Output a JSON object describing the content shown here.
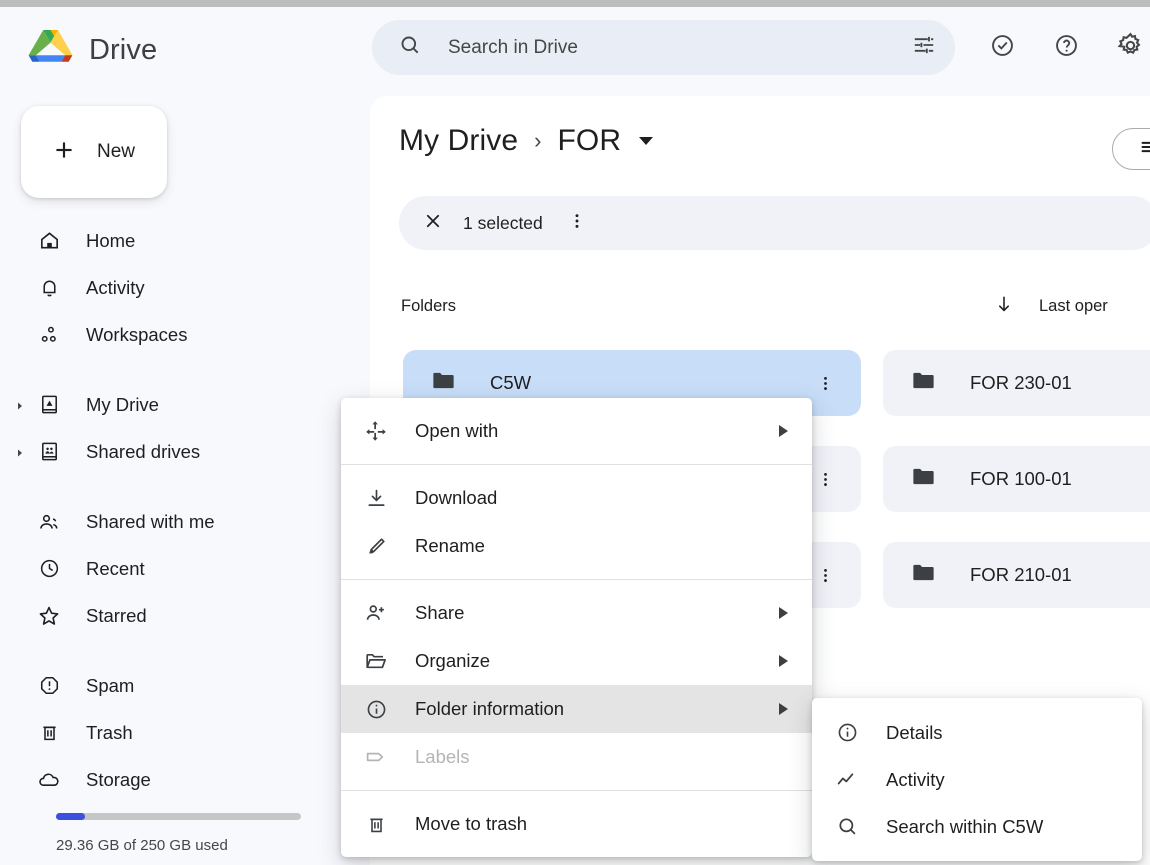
{
  "app": {
    "name": "Drive",
    "logo_icon": "google-drive-logo"
  },
  "sidebar": {
    "new_button": {
      "label": "New",
      "icon": "plus-icon"
    },
    "items": [
      {
        "label": "Home",
        "icon": "home-icon",
        "expandable": false
      },
      {
        "label": "Activity",
        "icon": "bell-icon",
        "expandable": false
      },
      {
        "label": "Workspaces",
        "icon": "workspaces-icon",
        "expandable": false
      },
      {
        "label": "My Drive",
        "icon": "my-drive-icon",
        "expandable": true
      },
      {
        "label": "Shared drives",
        "icon": "shared-drives-icon",
        "expandable": true
      },
      {
        "label": "Shared with me",
        "icon": "people-icon",
        "expandable": false
      },
      {
        "label": "Recent",
        "icon": "clock-icon",
        "expandable": false
      },
      {
        "label": "Starred",
        "icon": "star-icon",
        "expandable": false
      },
      {
        "label": "Spam",
        "icon": "spam-icon",
        "expandable": false
      },
      {
        "label": "Trash",
        "icon": "trash-icon",
        "expandable": false
      },
      {
        "label": "Storage",
        "icon": "cloud-icon",
        "expandable": false
      }
    ],
    "storage": {
      "used_text": "29.36 GB of 250 GB used",
      "percent": 12,
      "fill_color": "#3b50df",
      "track_color": "#c4c7c5"
    }
  },
  "header": {
    "search": {
      "placeholder": "Search in Drive",
      "value": "",
      "search_icon": "search-icon",
      "options_icon": "tune-icon"
    },
    "icons": [
      {
        "name": "tasks-check-icon"
      },
      {
        "name": "help-icon"
      },
      {
        "name": "settings-gear-icon"
      }
    ]
  },
  "breadcrumb": {
    "root": "My Drive",
    "separator": "›",
    "current": "FOR",
    "caret_icon": "chevron-down-icon"
  },
  "view_toggle": {
    "icon": "list-view-icon"
  },
  "selection_bar": {
    "close_icon": "close-icon",
    "count_label": "1 selected",
    "more_icon": "more-vert-icon"
  },
  "content": {
    "section_label": "Folders",
    "sort": {
      "direction_icon": "arrow-down-icon",
      "label": "Last oper"
    },
    "rows": [
      [
        {
          "name": "C5W",
          "icon": "folder-icon",
          "selected": true,
          "more_icon": "more-vert-icon"
        },
        {
          "name": "FOR 230-01",
          "icon": "folder-icon",
          "selected": false,
          "more_icon": "more-vert-icon"
        }
      ],
      [
        {
          "name": "",
          "icon": "folder-icon",
          "selected": false,
          "more_icon": "more-vert-icon"
        },
        {
          "name": "FOR 100-01",
          "icon": "folder-icon",
          "selected": false,
          "more_icon": "more-vert-icon"
        }
      ],
      [
        {
          "name": "",
          "icon": "folder-icon",
          "selected": false,
          "more_icon": "more-vert-icon"
        },
        {
          "name": "FOR 210-01",
          "icon": "folder-icon",
          "selected": false,
          "more_icon": "more-vert-icon"
        }
      ]
    ]
  },
  "context_menu": {
    "items": [
      {
        "label": "Open with",
        "icon": "open-with-icon",
        "submenu": true,
        "disabled": false,
        "highlighted": false
      },
      {
        "label": "Download",
        "icon": "download-icon",
        "submenu": false,
        "disabled": false,
        "highlighted": false
      },
      {
        "label": "Rename",
        "icon": "rename-pencil-icon",
        "submenu": false,
        "disabled": false,
        "highlighted": false
      },
      {
        "label": "Share",
        "icon": "person-add-icon",
        "submenu": true,
        "disabled": false,
        "highlighted": false
      },
      {
        "label": "Organize",
        "icon": "folder-move-icon",
        "submenu": true,
        "disabled": false,
        "highlighted": false
      },
      {
        "label": "Folder information",
        "icon": "info-circle-icon",
        "submenu": true,
        "disabled": false,
        "highlighted": true
      },
      {
        "label": "Labels",
        "icon": "label-tag-icon",
        "submenu": false,
        "disabled": true,
        "highlighted": false
      },
      {
        "label": "Move to trash",
        "icon": "trash-icon",
        "submenu": false,
        "disabled": false,
        "highlighted": false
      }
    ]
  },
  "submenu": {
    "items": [
      {
        "label": "Details",
        "icon": "info-circle-icon"
      },
      {
        "label": "Activity",
        "icon": "activity-line-icon"
      },
      {
        "label": "Search within C5W",
        "icon": "search-icon"
      }
    ]
  }
}
